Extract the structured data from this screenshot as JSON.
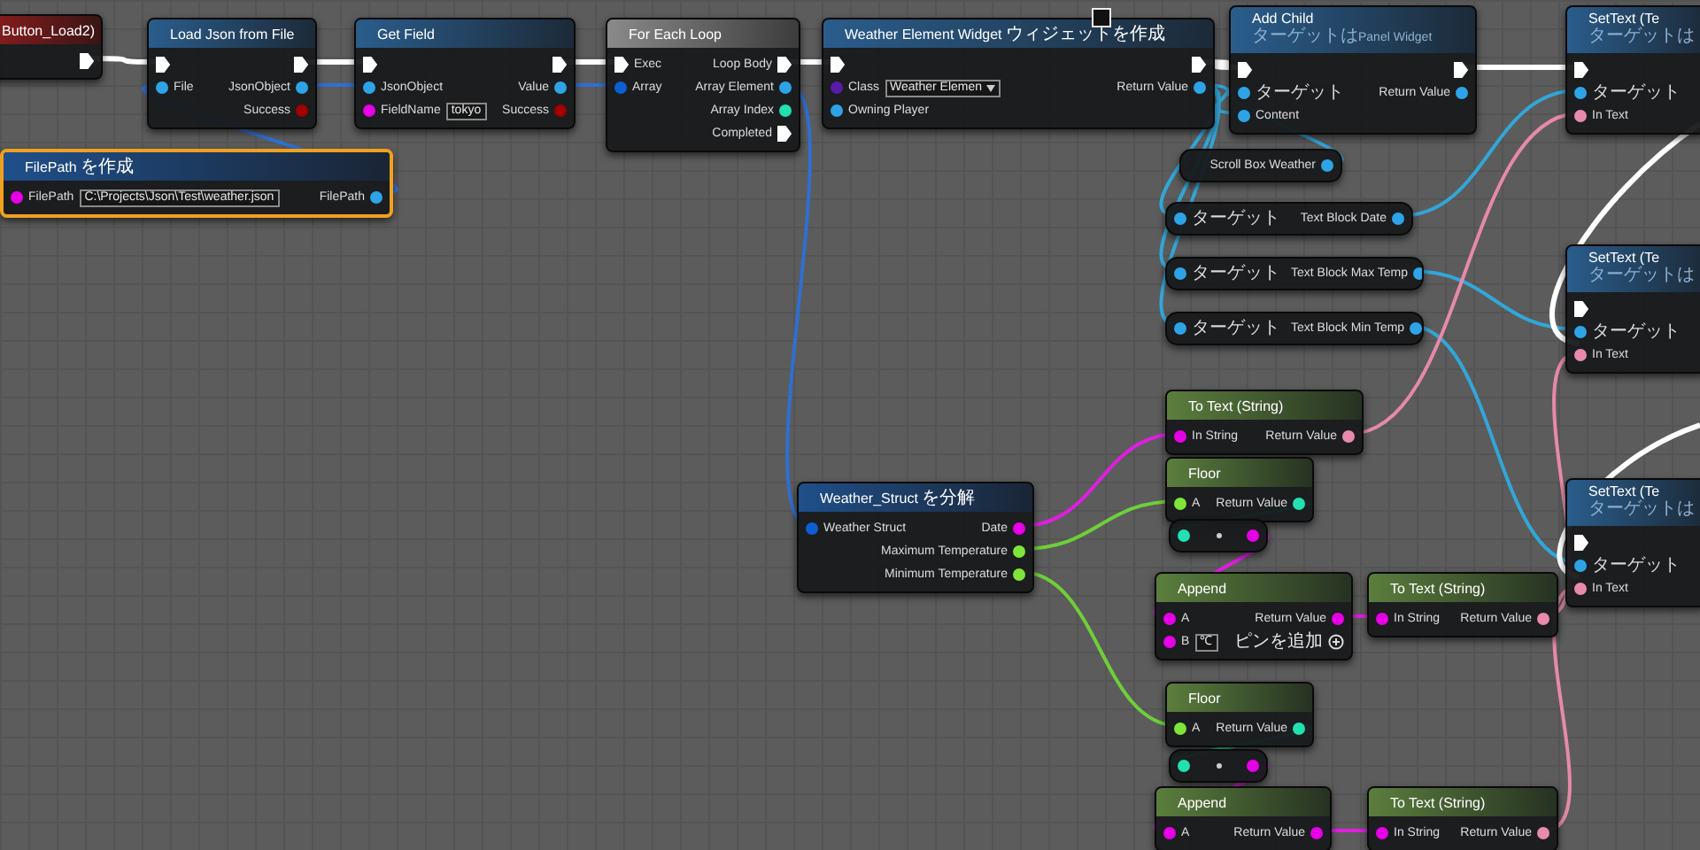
{
  "nodes": [
    {
      "kind": "event",
      "title": "Button_Load2)",
      "selected": false,
      "rows": [
        {
          "right": {
            "kind": "exec"
          }
        }
      ]
    },
    {
      "kind": "function",
      "title": "Load Json from File",
      "selected": false,
      "rows": [
        {
          "left": {
            "kind": "exec"
          },
          "right": {
            "kind": "exec"
          }
        },
        {
          "left": {
            "kind": "object",
            "label": "File"
          },
          "right": {
            "kind": "object",
            "label": "JsonObject"
          }
        },
        {
          "right": {
            "kind": "bool",
            "label": "Success"
          }
        }
      ]
    },
    {
      "kind": "function",
      "title": "Get Field",
      "selected": false,
      "rows": [
        {
          "left": {
            "kind": "exec"
          },
          "right": {
            "kind": "exec"
          }
        },
        {
          "left": {
            "kind": "object",
            "label": "JsonObject"
          },
          "right": {
            "kind": "object",
            "label": "Value"
          }
        },
        {
          "left": {
            "kind": "string",
            "label": "FieldName",
            "value": "tokyo"
          },
          "right": {
            "kind": "bool",
            "label": "Success"
          }
        }
      ]
    },
    {
      "kind": "macro",
      "title": "For Each Loop",
      "selected": false,
      "rows": [
        {
          "left": {
            "kind": "exec",
            "label": "Exec"
          },
          "right": {
            "kind": "exec",
            "label": "Loop Body"
          }
        },
        {
          "left": {
            "kind": "struct",
            "label": "Array"
          },
          "right": {
            "kind": "object",
            "label": "Array Element"
          }
        },
        {
          "right": {
            "kind": "int",
            "label": "Array Index"
          }
        },
        {
          "right": {
            "kind": "exec",
            "label": "Completed"
          }
        }
      ]
    },
    {
      "kind": "function",
      "title": "Weather Element Widget ウィジェットを作成",
      "selected": false,
      "rows": [
        {
          "left": {
            "kind": "exec"
          },
          "right": {
            "kind": "exec"
          }
        },
        {
          "left": {
            "kind": "class",
            "label": "Class",
            "value": "Weather Elemen"
          },
          "right": {
            "kind": "object",
            "label": "Return Value"
          }
        },
        {
          "left": {
            "kind": "object",
            "label": "Owning Player"
          }
        }
      ]
    },
    {
      "kind": "function",
      "title": "Add Child",
      "subtitle": "ターゲットはPanel Widget",
      "selected": false,
      "rows": [
        {
          "left": {
            "kind": "exec"
          },
          "right": {
            "kind": "exec"
          }
        },
        {
          "left": {
            "kind": "object",
            "label": "ターゲット"
          },
          "right": {
            "kind": "object",
            "label": "Return Value"
          }
        },
        {
          "left": {
            "kind": "object",
            "label": "Content"
          }
        }
      ]
    },
    {
      "kind": "function",
      "title": "SetText (Te",
      "subtitle": "ターゲットは",
      "selected": false,
      "rows": [
        {
          "left": {
            "kind": "exec"
          }
        },
        {
          "left": {
            "kind": "object",
            "label": "ターゲット"
          }
        },
        {
          "left": {
            "kind": "text",
            "label": "In Text"
          }
        }
      ]
    },
    {
      "kind": "make",
      "title": "FilePath を作成",
      "selected": true,
      "rows": [
        {
          "left": {
            "kind": "string",
            "label": "FilePath",
            "value": "C:\\Projects\\Json\\Test\\weather.json"
          },
          "right": {
            "kind": "object",
            "label": "FilePath"
          }
        }
      ]
    },
    {
      "kind": "variable",
      "selected": false,
      "rows": [
        {
          "right": {
            "kind": "object",
            "label": "Scroll Box Weather"
          }
        }
      ]
    },
    {
      "kind": "variable",
      "selected": false,
      "rows": [
        {
          "left": {
            "kind": "object",
            "label": "ターゲット"
          },
          "right": {
            "kind": "object",
            "label": "Text Block Date"
          }
        }
      ]
    },
    {
      "kind": "variable",
      "selected": false,
      "rows": [
        {
          "left": {
            "kind": "object",
            "label": "ターゲット"
          },
          "right": {
            "kind": "object",
            "label": "Text Block Max Temp"
          }
        }
      ]
    },
    {
      "kind": "variable",
      "selected": false,
      "rows": [
        {
          "left": {
            "kind": "object",
            "label": "ターゲット"
          },
          "right": {
            "kind": "object",
            "label": "Text Block Min Temp"
          }
        }
      ]
    },
    {
      "kind": "function",
      "title": "SetText (Te",
      "subtitle": "ターゲットは",
      "selected": false,
      "rows": [
        {
          "left": {
            "kind": "exec"
          }
        },
        {
          "left": {
            "kind": "object",
            "label": "ターゲット"
          }
        },
        {
          "left": {
            "kind": "text",
            "label": "In Text"
          }
        }
      ]
    },
    {
      "kind": "pure",
      "title": "To Text (String)",
      "selected": false,
      "rows": [
        {
          "left": {
            "kind": "string",
            "label": "In String"
          },
          "right": {
            "kind": "text",
            "label": "Return Value"
          }
        }
      ]
    },
    {
      "kind": "break",
      "title": "Weather_Struct を分解",
      "selected": false,
      "rows": [
        {
          "left": {
            "kind": "struct",
            "label": "Weather Struct"
          },
          "right": {
            "kind": "string",
            "label": "Date"
          }
        },
        {
          "right": {
            "kind": "float",
            "label": "Maximum Temperature"
          }
        },
        {
          "right": {
            "kind": "float",
            "label": "Minimum Temperature"
          }
        }
      ]
    },
    {
      "kind": "pure",
      "title": "Floor",
      "selected": false,
      "rows": [
        {
          "left": {
            "kind": "float",
            "label": "A"
          },
          "right": {
            "kind": "int",
            "label": "Return Value"
          }
        }
      ]
    },
    {
      "kind": "convert",
      "selected": false,
      "rows": [
        {
          "left": {
            "kind": "int"
          },
          "right": {
            "kind": "string"
          }
        }
      ]
    },
    {
      "kind": "function",
      "title": "SetText (Te",
      "subtitle": "ターゲットは",
      "selected": false,
      "rows": [
        {
          "left": {
            "kind": "exec"
          }
        },
        {
          "left": {
            "kind": "object",
            "label": "ターゲット"
          }
        },
        {
          "left": {
            "kind": "text",
            "label": "In Text"
          }
        }
      ]
    },
    {
      "kind": "pure",
      "title": "Append",
      "selected": false,
      "rows": [
        {
          "left": {
            "kind": "string",
            "label": "A"
          },
          "right": {
            "kind": "string",
            "label": "Return Value"
          }
        },
        {
          "left": {
            "kind": "string",
            "label": "B",
            "value": "℃"
          },
          "right": {
            "kind": "add",
            "label": "ピンを追加"
          }
        }
      ]
    },
    {
      "kind": "pure",
      "title": "To Text (String)",
      "selected": false,
      "rows": [
        {
          "left": {
            "kind": "string",
            "label": "In String"
          },
          "right": {
            "kind": "text",
            "label": "Return Value"
          }
        }
      ]
    },
    {
      "kind": "pure",
      "title": "Floor",
      "selected": false,
      "rows": [
        {
          "left": {
            "kind": "float",
            "label": "A"
          },
          "right": {
            "kind": "int",
            "label": "Return Value"
          }
        }
      ]
    },
    {
      "kind": "convert",
      "selected": false,
      "rows": [
        {
          "left": {
            "kind": "int"
          },
          "right": {
            "kind": "string"
          }
        }
      ]
    },
    {
      "kind": "pure",
      "title": "Append",
      "selected": false,
      "rows": [
        {
          "left": {
            "kind": "string",
            "label": "A"
          },
          "right": {
            "kind": "string",
            "label": "Return Value"
          }
        }
      ]
    },
    {
      "kind": "pure",
      "title": "To Text (String)",
      "selected": false,
      "rows": [
        {
          "left": {
            "kind": "string",
            "label": "In String"
          },
          "right": {
            "kind": "text",
            "label": "Return Value"
          }
        }
      ]
    }
  ]
}
